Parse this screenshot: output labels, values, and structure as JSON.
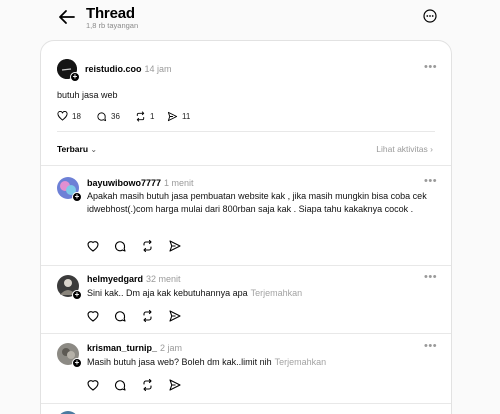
{
  "header": {
    "title": "Thread",
    "subtitle": "1,8 rb tayangan"
  },
  "post": {
    "username": "reistudio.coo",
    "time": "14 jam",
    "text": "butuh jasa web",
    "likes": "18",
    "replies": "36",
    "reposts": "1",
    "shares": "11"
  },
  "sort": {
    "label": "Terbaru",
    "activity_label": "Lihat aktivitas"
  },
  "replies": [
    {
      "username": "bayuwibowo7777",
      "time": "1 menit",
      "text": "Apakah masih butuh jasa pembuatan website kak , jika masih mungkin bisa coba cek idwebhost(.)com harga mulai dari 800rban saja kak . Siapa tahu kakaknya cocok .",
      "translate": ""
    },
    {
      "username": "helmyedgard",
      "time": "32 menit",
      "text": "Sini kak.. Dm aja kak kebutuhannya apa",
      "translate": "Terjemahkan"
    },
    {
      "username": "krisman_turnip_",
      "time": "2 jam",
      "text": "Masih butuh jasa web? Boleh dm kak..limit nih",
      "translate": "Terjemahkan"
    }
  ],
  "icons": {
    "back": "arrow-left-icon",
    "more": "more-circle-icon",
    "like": "heart-icon",
    "reply": "comment-icon",
    "repost": "repost-icon",
    "share": "send-icon"
  }
}
